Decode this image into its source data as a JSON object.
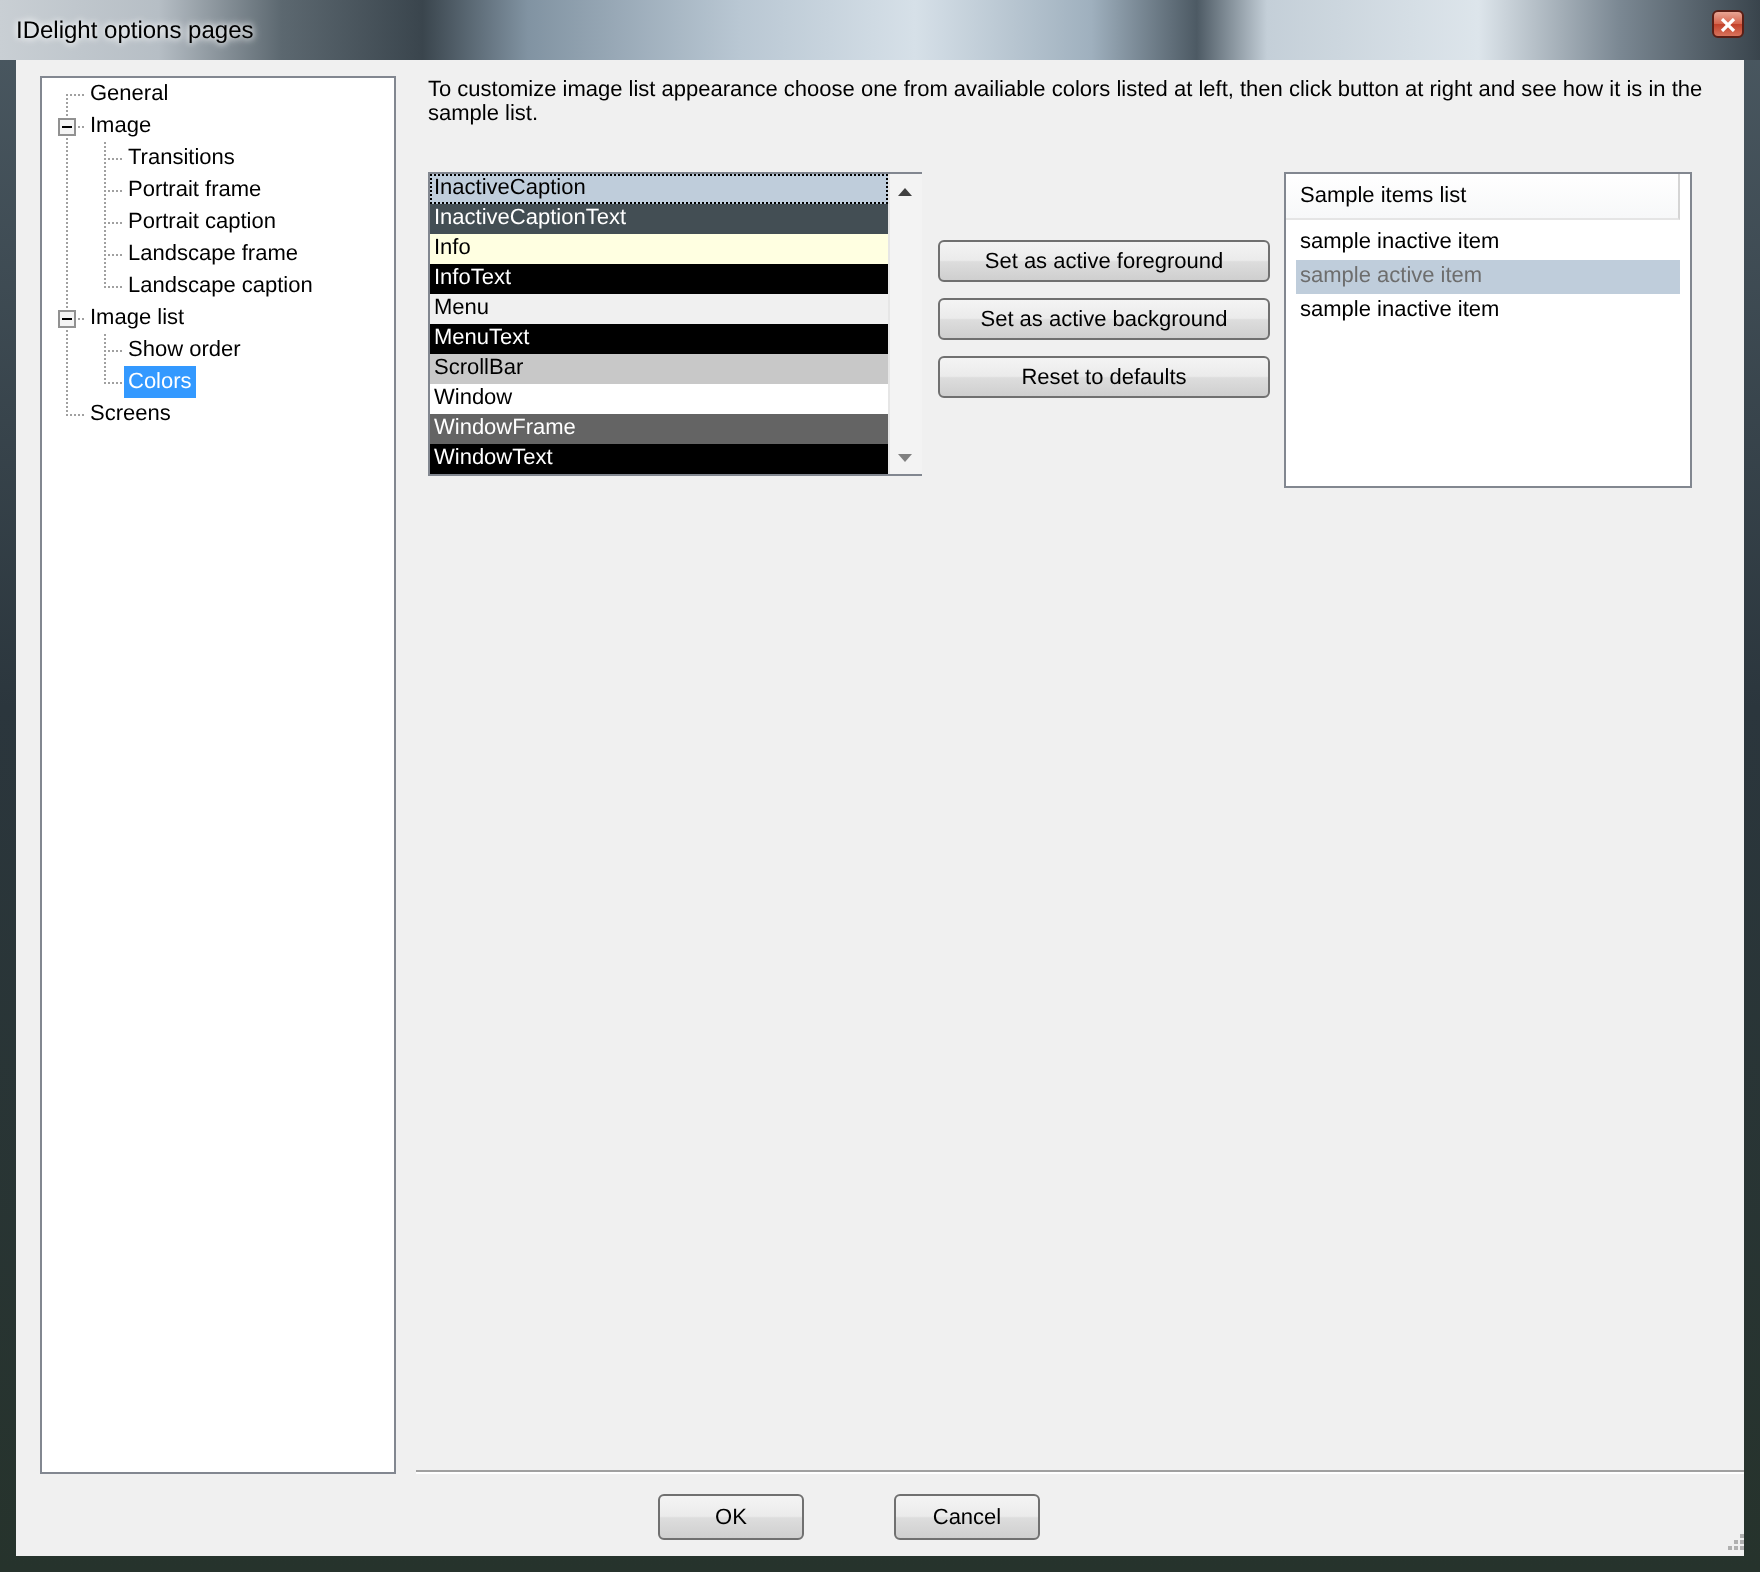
{
  "window": {
    "title": "IDelight options pages"
  },
  "tree": {
    "items": [
      {
        "label": "General",
        "selected": false
      },
      {
        "label": "Image",
        "selected": false,
        "expanded": true,
        "children": [
          {
            "label": "Transitions",
            "selected": false
          },
          {
            "label": "Portrait frame",
            "selected": false
          },
          {
            "label": "Portrait caption",
            "selected": false
          },
          {
            "label": "Landscape frame",
            "selected": false
          },
          {
            "label": "Landscape caption",
            "selected": false
          }
        ]
      },
      {
        "label": "Image list",
        "selected": false,
        "expanded": true,
        "children": [
          {
            "label": "Show order",
            "selected": false
          },
          {
            "label": "Colors",
            "selected": true
          }
        ]
      },
      {
        "label": "Screens",
        "selected": false
      }
    ]
  },
  "instructions": "To customize image list appearance choose one from availiable colors listed at left, then click button at right and see how it is in the sample list.",
  "color_list": {
    "items": [
      {
        "label": "InactiveCaption",
        "color": "#bfcddb",
        "focused": true
      },
      {
        "label": "InactiveCaptionText",
        "color": "#434e54",
        "focused": false
      },
      {
        "label": "Info",
        "color": "#ffffe1",
        "focused": false
      },
      {
        "label": "InfoText",
        "color": "#000000",
        "focused": false
      },
      {
        "label": "Menu",
        "color": "#f0f0f0",
        "focused": false
      },
      {
        "label": "MenuText",
        "color": "#000000",
        "focused": false
      },
      {
        "label": "ScrollBar",
        "color": "#c8c8c8",
        "focused": false
      },
      {
        "label": "Window",
        "color": "#ffffff",
        "focused": false
      },
      {
        "label": "WindowFrame",
        "color": "#646464",
        "focused": false
      },
      {
        "label": "WindowText",
        "color": "#000000",
        "focused": false
      }
    ]
  },
  "actions": [
    "Set as active foreground",
    "Set as active background",
    "Reset to defaults"
  ],
  "sample_list": {
    "header": "Sample items list",
    "items": [
      {
        "label": "sample inactive item",
        "active": false
      },
      {
        "label": "sample active item",
        "active": true
      },
      {
        "label": "sample inactive item",
        "active": false
      }
    ]
  },
  "buttons": [
    "OK",
    "Cancel"
  ]
}
